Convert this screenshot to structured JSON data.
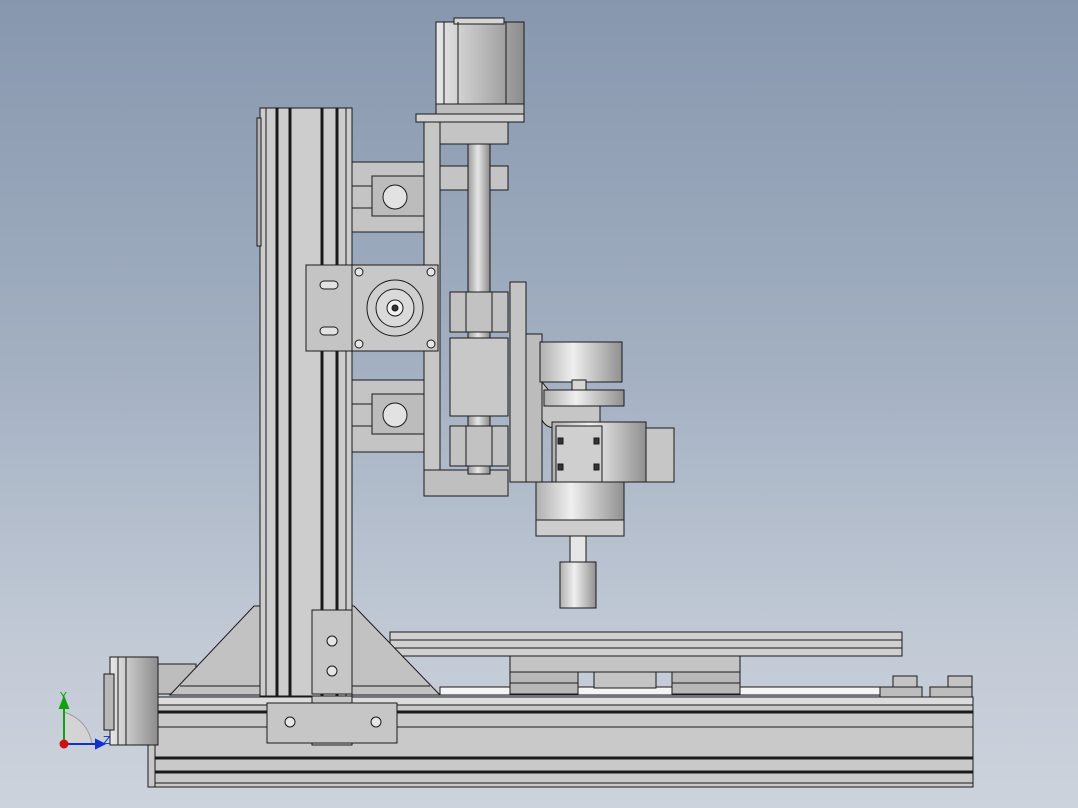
{
  "viewport": {
    "background_top": "#8797ad",
    "background_bottom": "#cdd3dc",
    "part_fill": "#c8c8c8",
    "part_edge": "#1a1a1a"
  },
  "triad": {
    "y_label": "Y",
    "z_label": "Z",
    "x_color": "#d01010",
    "y_color": "#10a010",
    "z_color": "#1030d0"
  }
}
